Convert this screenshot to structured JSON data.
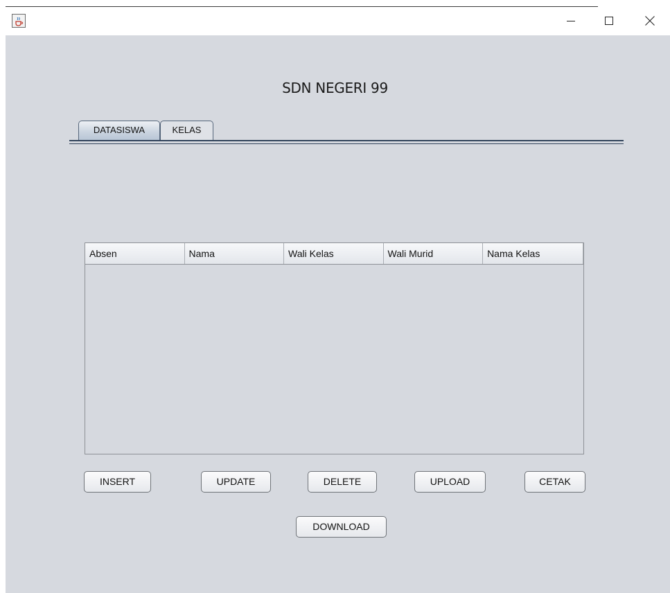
{
  "window": {
    "icon": "java-cup-icon",
    "controls": {
      "minimize": "minimize-icon",
      "maximize": "maximize-icon",
      "close": "close-icon"
    }
  },
  "main": {
    "title": "SDN NEGERI 99",
    "tabs": [
      {
        "label": "DATASISWA",
        "active": true
      },
      {
        "label": "KELAS",
        "active": false
      }
    ],
    "table": {
      "columns": [
        "Absen",
        "Nama",
        "Wali Kelas",
        "Wali Murid",
        "Nama Kelas"
      ],
      "rows": []
    },
    "buttons": {
      "insert": "INSERT",
      "update": "UPDATE",
      "delete": "DELETE",
      "upload": "UPLOAD",
      "cetak": "CETAK",
      "download": "DOWNLOAD"
    }
  },
  "colors": {
    "background": "#d6d9df",
    "tab_border": "#32445c"
  }
}
